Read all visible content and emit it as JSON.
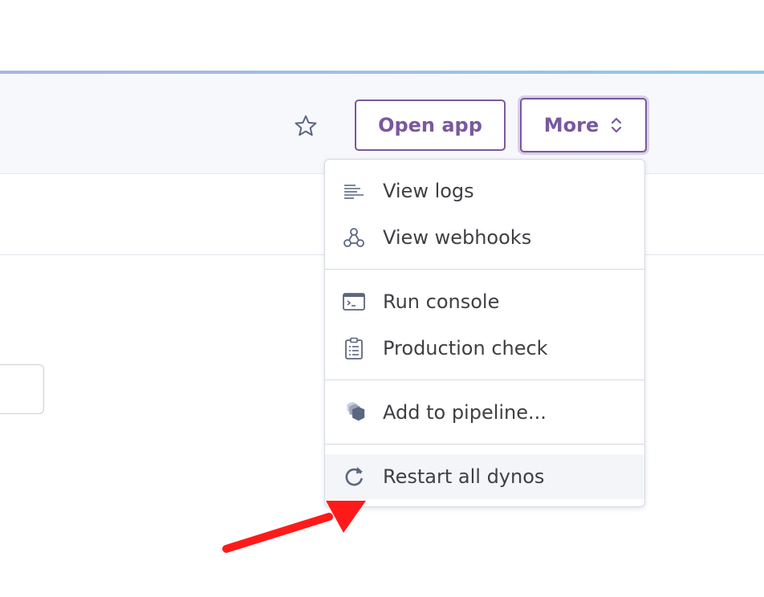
{
  "header": {
    "open_app_label": "Open app",
    "more_label": "More"
  },
  "menu": {
    "items": [
      {
        "label": "View logs",
        "icon": "logs-icon"
      },
      {
        "label": "View webhooks",
        "icon": "webhooks-icon"
      },
      {
        "label": "Run console",
        "icon": "console-icon"
      },
      {
        "label": "Production check",
        "icon": "clipboard-icon"
      },
      {
        "label": "Add to pipeline...",
        "icon": "pipeline-icon"
      },
      {
        "label": "Restart all dynos",
        "icon": "restart-icon"
      }
    ]
  },
  "colors": {
    "accent": "#79589f",
    "icon": "#5b6680",
    "text": "#3f3f44",
    "annotation_arrow": "#ff1a1a"
  }
}
